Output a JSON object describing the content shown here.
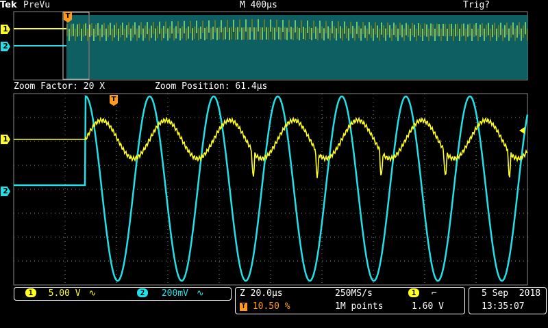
{
  "header": {
    "brand": "Tek",
    "acq_mode": "PreVu",
    "horizontal_scale": "M 400µs",
    "trigger_status": "Trig?"
  },
  "zoom": {
    "factor": "Zoom Factor: 20 X",
    "position": "Zoom Position: 61.4µs"
  },
  "channels": [
    {
      "id": "1",
      "color": "#ffff22",
      "scale": "5.00 V",
      "coupling_symbol": "∿"
    },
    {
      "id": "2",
      "color": "#22e0e8",
      "scale": "200mV",
      "coupling_symbol": "∿"
    }
  ],
  "trigger_marker": "T",
  "timebase": {
    "zoom_scale": "Z 20.0µs",
    "trigger_position": "10.50 %",
    "sample_rate": "250MS/s",
    "record_length": "1M points",
    "trigger_source": "1",
    "trigger_slope_symbol": "⌐",
    "trigger_level": "1.60 V"
  },
  "datetime": {
    "date": "5 Sep  2018",
    "time": "13:35:07"
  },
  "colors": {
    "graticule": "#8a8a8a",
    "ch1": "#ffff22",
    "ch2": "#22e0e8",
    "trigger": "#ff9a1c"
  }
}
